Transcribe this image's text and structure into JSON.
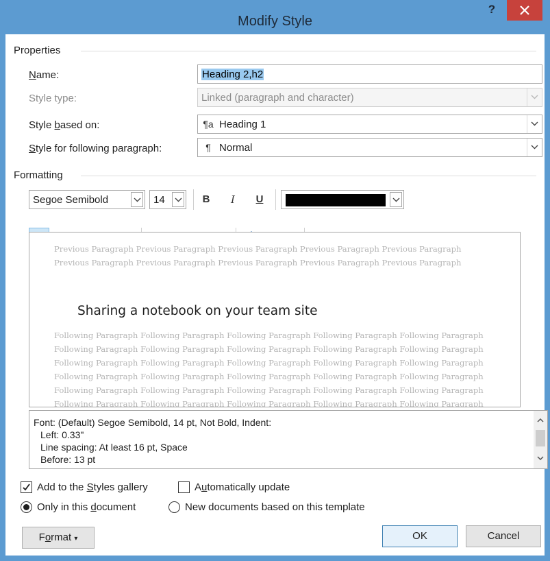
{
  "window": {
    "title": "Modify Style",
    "help": "?"
  },
  "properties": {
    "section_label": "Properties",
    "name_label": "Name:",
    "name_value": "Heading 2,h2",
    "style_type_label": "Style type:",
    "style_type_value": "Linked (paragraph and character)",
    "based_on_label": "Style based on:",
    "based_on_icon": "linked-style-icon",
    "based_on_value": "Heading 1",
    "following_label": "Style for following paragraph:",
    "following_icon": "paragraph-mark-icon",
    "following_value": "Normal"
  },
  "formatting": {
    "section_label": "Formatting",
    "font": "Segoe Semibold",
    "size": "14",
    "bold": "B",
    "italic": "I",
    "underline": "U",
    "color": "#000000"
  },
  "preview": {
    "previous": "Previous Paragraph Previous Paragraph Previous Paragraph Previous Paragraph Previous Paragraph Previous Paragraph Previous Paragraph Previous Paragraph Previous Paragraph Previous Paragraph",
    "heading": "Sharing a notebook on your team site",
    "following": "Following Paragraph Following Paragraph Following Paragraph Following Paragraph Following Paragraph Following Paragraph Following Paragraph Following Paragraph Following Paragraph Following Paragraph Following Paragraph Following Paragraph Following Paragraph Following Paragraph Following Paragraph Following Paragraph Following Paragraph Following Paragraph Following Paragraph Following Paragraph Following Paragraph Following Paragraph Following Paragraph Following Paragraph Following Paragraph Following Paragraph Following Paragraph Following Paragraph Following Paragraph Following Paragraph"
  },
  "description": {
    "line1": "Font: (Default) Segoe Semibold, 14 pt, Not Bold, Indent:",
    "line2": "Left:  0.33\"",
    "line3": "Line spacing:  At least 16 pt, Space",
    "line4": "Before:  13 pt"
  },
  "options": {
    "add_gallery": "Add to the Styles gallery",
    "auto_update": "Automatically update",
    "only_doc": "Only in this document",
    "new_docs": "New documents based on this template"
  },
  "buttons": {
    "format": "Format",
    "ok": "OK",
    "cancel": "Cancel"
  }
}
